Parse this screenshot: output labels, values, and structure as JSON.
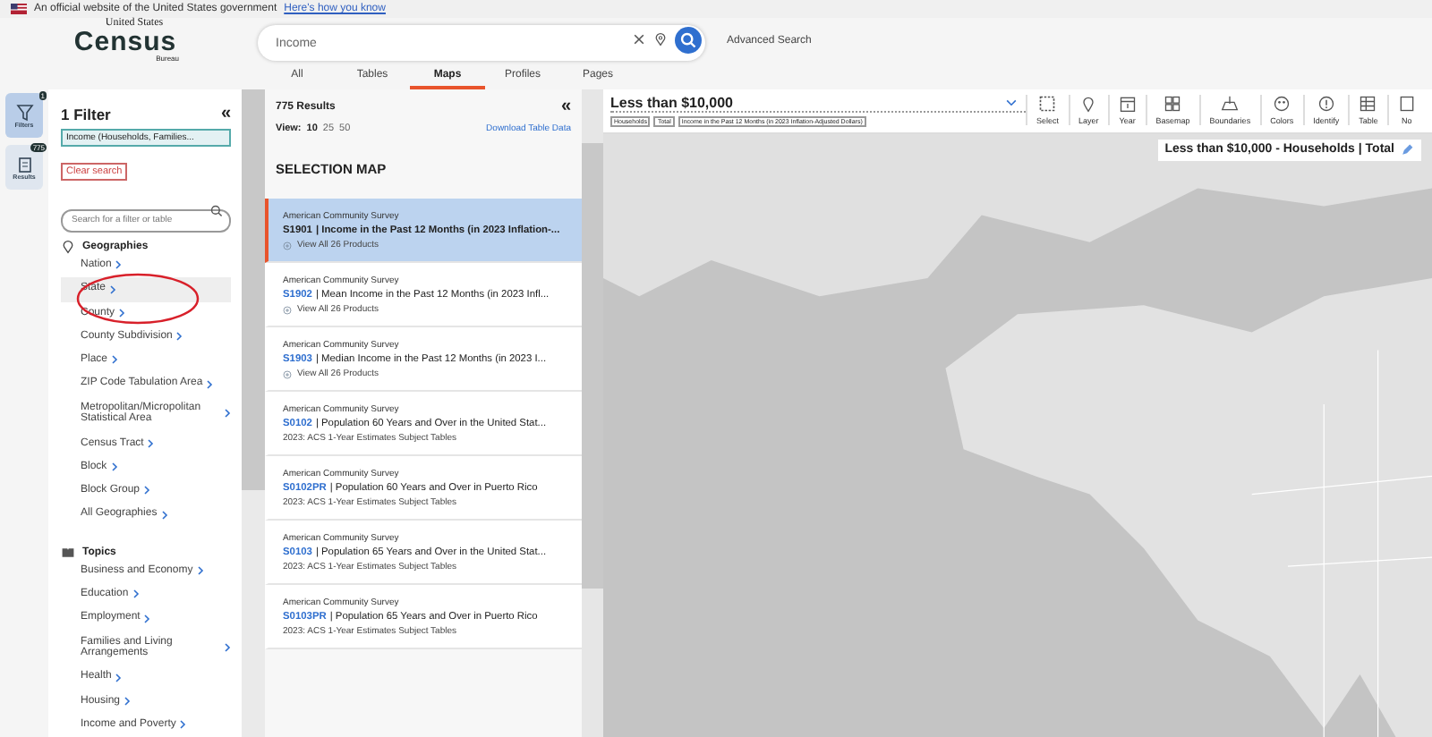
{
  "banner": {
    "text": "An official website of the United States government",
    "link": "Here's how you know"
  },
  "logo": {
    "top": "United States",
    "name": "Census",
    "bottom": "Bureau"
  },
  "search": {
    "value": "Income",
    "advanced": "Advanced Search"
  },
  "tabs": [
    {
      "label": "All",
      "selected": false
    },
    {
      "label": "Tables",
      "selected": false
    },
    {
      "label": "Maps",
      "selected": true
    },
    {
      "label": "Profiles",
      "selected": false
    },
    {
      "label": "Pages",
      "selected": false
    }
  ],
  "rail": [
    {
      "label": "Filters",
      "badge": "1",
      "selected": true
    },
    {
      "label": "Results",
      "badge": "775",
      "selected": false
    }
  ],
  "filters": {
    "title": "1 Filter",
    "collapse": "«",
    "chip": "Income (Households, Families...",
    "clear": "Clear search",
    "placeholder": "Search for a filter or table",
    "sections": [
      {
        "kind": "pin",
        "title": "Geographies",
        "items": [
          {
            "label": "Nation",
            "selected": false
          },
          {
            "label": "State",
            "selected": true
          },
          {
            "label": "County",
            "selected": false
          },
          {
            "label": "County Subdivision",
            "selected": false
          },
          {
            "label": "Place",
            "selected": false
          },
          {
            "label": "ZIP Code Tabulation Area",
            "selected": false
          },
          {
            "label": "Metropolitan/Micropolitan Statistical Area",
            "selected": false
          },
          {
            "label": "Census Tract",
            "selected": false
          },
          {
            "label": "Block",
            "selected": false
          },
          {
            "label": "Block Group",
            "selected": false
          },
          {
            "label": "All Geographies",
            "selected": false
          }
        ]
      },
      {
        "kind": "book",
        "title": "Topics",
        "items": [
          {
            "label": "Business and Economy",
            "selected": false
          },
          {
            "label": "Education",
            "selected": false
          },
          {
            "label": "Employment",
            "selected": false
          },
          {
            "label": "Families and Living Arrangements",
            "selected": false
          },
          {
            "label": "Health",
            "selected": false
          },
          {
            "label": "Housing",
            "selected": false
          },
          {
            "label": "Income and Poverty",
            "selected": false
          }
        ]
      }
    ]
  },
  "results": {
    "count": "775 Results",
    "collapse": "«",
    "view_label": "View:",
    "views": [
      {
        "label": "10",
        "selected": true
      },
      {
        "label": "25",
        "selected": false
      },
      {
        "label": "50",
        "selected": false
      }
    ],
    "download": "Download Table Data",
    "heading": "SELECTION MAP",
    "items": [
      {
        "kind": "products",
        "survey": "American Community Survey",
        "code": "S1901",
        "title": "| Income in the Past 12 Months (in 2023 Inflation-...",
        "note": "View All 26 Products",
        "selected": true
      },
      {
        "kind": "products",
        "survey": "American Community Survey",
        "code": "S1902",
        "title": "| Mean Income in the Past 12 Months (in 2023 Infl...",
        "note": "View All 26 Products",
        "selected": false
      },
      {
        "kind": "products",
        "survey": "American Community Survey",
        "code": "S1903",
        "title": "| Median Income in the Past 12 Months (in 2023 I...",
        "note": "View All 26 Products",
        "selected": false
      },
      {
        "kind": "tables",
        "survey": "American Community Survey",
        "code": "S0102",
        "title": "| Population 60 Years and Over in the United Stat...",
        "note": "2023: ACS 1-Year Estimates Subject Tables",
        "selected": false
      },
      {
        "kind": "tables",
        "survey": "American Community Survey",
        "code": "S0102PR",
        "title": "| Population 60 Years and Over in Puerto Rico",
        "note": "2023: ACS 1-Year Estimates Subject Tables",
        "selected": false
      },
      {
        "kind": "tables",
        "survey": "American Community Survey",
        "code": "S0103",
        "title": "| Population 65 Years and Over in the United Stat...",
        "note": "2023: ACS 1-Year Estimates Subject Tables",
        "selected": false
      },
      {
        "kind": "tables",
        "survey": "American Community Survey",
        "code": "S0103PR",
        "title": "| Population 65 Years and Over in Puerto Rico",
        "note": "2023: ACS 1-Year Estimates Subject Tables",
        "selected": false
      }
    ]
  },
  "map": {
    "title": "Less than $10,000",
    "tags": [
      "Households",
      "Total",
      "Income in the Past 12 Months (in 2023 Inflation-Adjusted Dollars)"
    ],
    "tools": [
      {
        "kind": "select",
        "label": "Select"
      },
      {
        "kind": "layer",
        "label": "Layer"
      },
      {
        "kind": "year",
        "label": "Year"
      },
      {
        "kind": "basemap",
        "label": "Basemap"
      },
      {
        "kind": "boundaries",
        "label": "Boundaries"
      },
      {
        "kind": "colors",
        "label": "Colors"
      },
      {
        "kind": "identify",
        "label": "Identify"
      },
      {
        "kind": "table",
        "label": "Table"
      },
      {
        "kind": "notes",
        "label": "No"
      }
    ],
    "legend": "Less than $10,000 - Households | Total"
  }
}
